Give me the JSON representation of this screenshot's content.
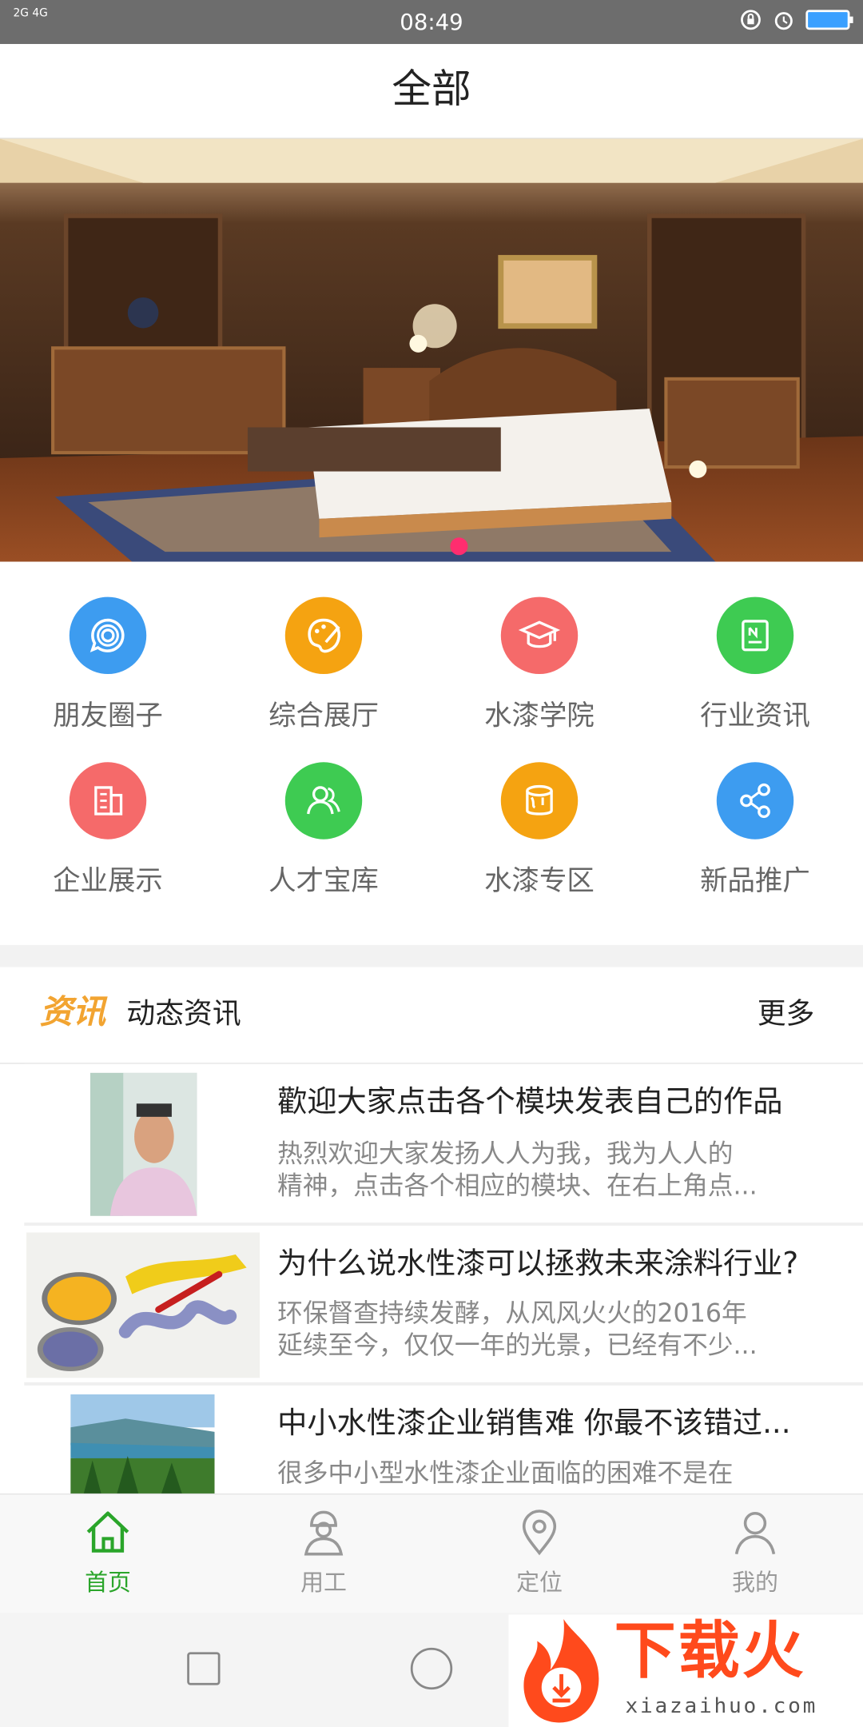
{
  "status_bar": {
    "network": "2G 4G",
    "time": "08:49",
    "icons": [
      "lock-rotate-icon",
      "alarm-icon",
      "battery-charging-icon"
    ]
  },
  "header": {
    "title": "全部"
  },
  "banner": {
    "image": "luxury-bedroom-photo",
    "pages": 1,
    "active_page": 1
  },
  "grid": {
    "items": [
      {
        "label": "朋友圈子",
        "icon": "chat-bubble-icon",
        "color": "#3d9cf0"
      },
      {
        "label": "综合展厅",
        "icon": "palette-icon",
        "color": "#f5a311"
      },
      {
        "label": "水漆学院",
        "icon": "graduation-cap-icon",
        "color": "#f56a6a"
      },
      {
        "label": "行业资讯",
        "icon": "newspaper-icon",
        "color": "#3ecb52"
      },
      {
        "label": "企业展示",
        "icon": "building-icon",
        "color": "#f56a6a"
      },
      {
        "label": "人才宝库",
        "icon": "people-icon",
        "color": "#3ecb52"
      },
      {
        "label": "水漆专区",
        "icon": "paint-bucket-icon",
        "color": "#f5a311"
      },
      {
        "label": "新品推广",
        "icon": "share-icon",
        "color": "#3d9cf0"
      }
    ]
  },
  "news": {
    "brand": "资讯",
    "section_title": "动态资讯",
    "more": "更多",
    "items": [
      {
        "title": "歡迎大家点击各个模块发表自己的作品",
        "desc1": "热烈欢迎大家发扬人人为我，我为人人的",
        "desc2": "精神，点击各个相应的模块、在右上角点...",
        "thumb": "man-portrait-photo"
      },
      {
        "title": "为什么说水性漆可以拯救未来涂料行业?",
        "desc1": " 环保督查持续发酵，从风风火火的2016年",
        "desc2": "延续至今，仅仅一年的光景，已经有不少...",
        "thumb": "paint-cans-photo"
      },
      {
        "title": "中小水性漆企业销售难 你最不该错过...",
        "desc1": " 很多中小型水性漆企业面临的困难不是在",
        "desc2": "",
        "thumb": "lake-landscape-photo"
      }
    ]
  },
  "tabbar": {
    "items": [
      {
        "label": "首页",
        "icon": "home-icon",
        "active": true
      },
      {
        "label": "用工",
        "icon": "worker-icon",
        "active": false
      },
      {
        "label": "定位",
        "icon": "location-pin-icon",
        "active": false
      },
      {
        "label": "我的",
        "icon": "user-icon",
        "active": false
      }
    ],
    "active_color": "#2aa52a",
    "inactive_color": "#999999"
  },
  "watermark": {
    "name": "下载火",
    "url": "xiazaihuo.com"
  }
}
